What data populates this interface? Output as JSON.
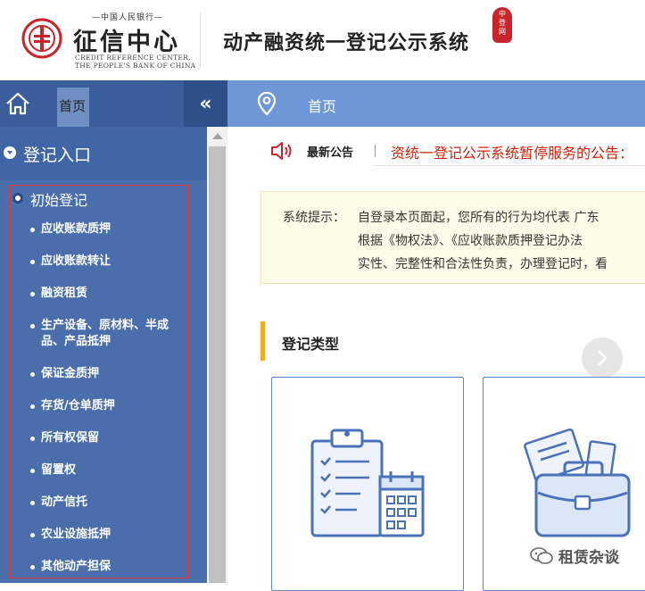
{
  "header": {
    "logo_top": "—中国人民银行—",
    "logo_name": "征信中心",
    "logo_en_line1": "CREDIT REFERENCE CENTER,",
    "logo_en_line2": "THE PEOPLE'S BANK OF CHINA",
    "system_title": "动产融资统一登记公示系统",
    "seal_chars": [
      "中",
      "登",
      "网"
    ]
  },
  "sidebar": {
    "home_tab": "首页",
    "collapse_glyph": "«",
    "entry_title": "登记入口",
    "group_title": "初始登记",
    "items": [
      {
        "label": "应收账款质押"
      },
      {
        "label": "应收账款转让"
      },
      {
        "label": "融资租赁"
      },
      {
        "label": "生产设备、原材料、半成品、产品抵押"
      },
      {
        "label": "保证金质押"
      },
      {
        "label": "存货/仓单质押"
      },
      {
        "label": "所有权保留"
      },
      {
        "label": "留置权"
      },
      {
        "label": "动产信托"
      },
      {
        "label": "农业设施抵押"
      },
      {
        "label": "其他动产担保"
      }
    ]
  },
  "topbar": {
    "breadcrumb": "首页"
  },
  "notice": {
    "label": "最新公告",
    "separator": "|",
    "text": "资统一登记公示系统暂停服务的公告："
  },
  "tips": {
    "label": "系统提示：",
    "line1": "自登录本页面起，您所有的行为均代表 广东",
    "line2": "根据《物权法》、《应收账款质押登记办法",
    "line3": "实性、完整性和合法性负责，办理登记时，看"
  },
  "section": {
    "title": "登记类型"
  },
  "watermark": {
    "text": "租赁杂谈"
  },
  "colors": {
    "sidebar_bg": "#4a6eab",
    "topbar_bg": "#6d97d6",
    "notice_red": "#d81e06",
    "accent_orange": "#f5a623",
    "card_border": "#5a87c9"
  }
}
